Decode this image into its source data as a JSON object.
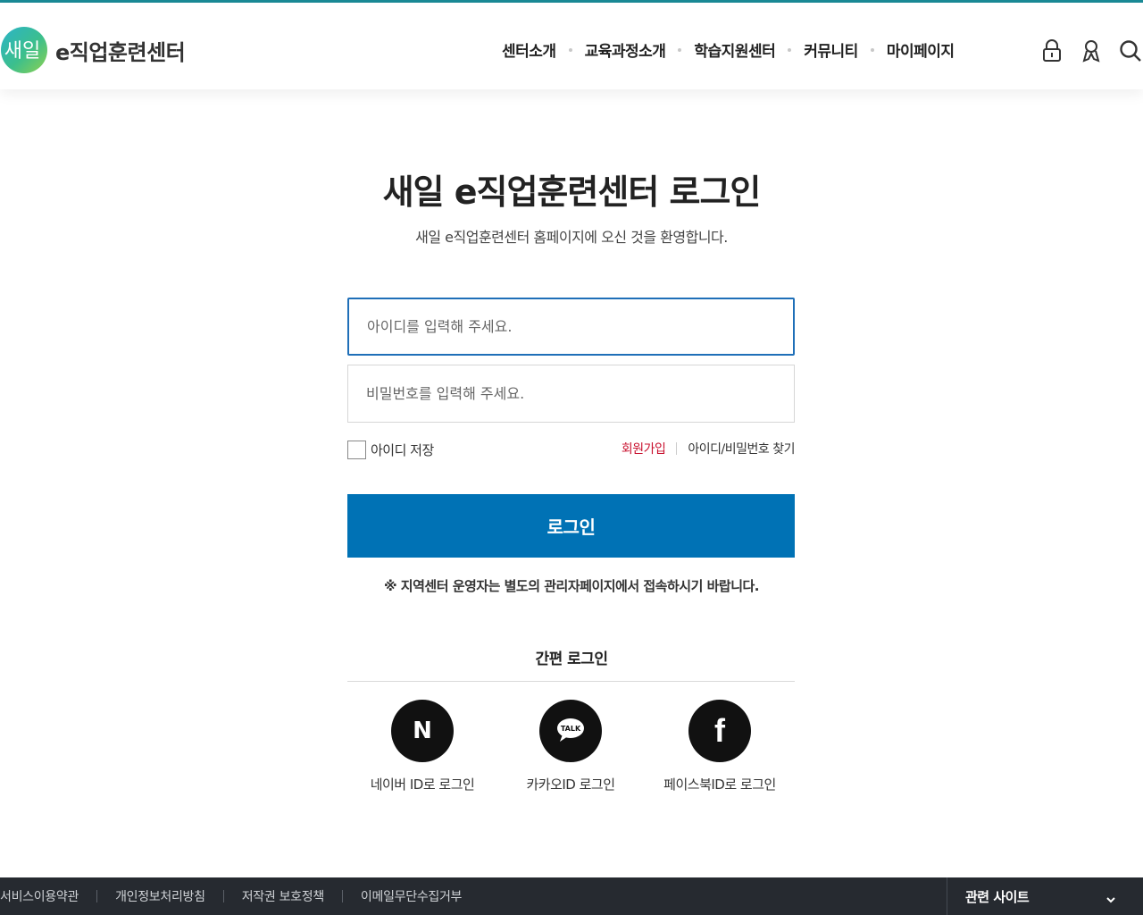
{
  "brand": {
    "mark_text": "새일",
    "name": "e직업훈련센터"
  },
  "nav": {
    "items": [
      {
        "id": "center",
        "label": "센터소개"
      },
      {
        "id": "course",
        "label": "교육과정소개"
      },
      {
        "id": "support",
        "label": "학습지원센터"
      },
      {
        "id": "community",
        "label": "커뮤니티"
      },
      {
        "id": "mypage",
        "label": "마이페이지"
      }
    ]
  },
  "utility": {
    "icons": [
      "lock-icon",
      "user-icon",
      "search-icon"
    ]
  },
  "login": {
    "title": "새일 e직업훈련센터 로그인",
    "subtitle": "새일 e직업훈련센터 홈페이지에 오신 것을 환영합니다.",
    "id_placeholder": "아이디를 입력해 주세요.",
    "pw_placeholder": "비밀번호를 입력해 주세요.",
    "save_id_label": "아이디 저장",
    "join_label": "회원가입",
    "find_label": "아이디/비밀번호 찾기",
    "button_label": "로그인",
    "notice": "※ 지역센터 운영자는 별도의 관리자페이지에서 접속하시기 바랍니다."
  },
  "easy_login": {
    "title": "간편 로그인",
    "providers": [
      {
        "id": "naver",
        "label": "네이버 ID로 로그인",
        "icon": "naver-icon",
        "glyph": "N"
      },
      {
        "id": "kakao",
        "label": "카카오ID 로그인",
        "icon": "kakao-talk-icon",
        "glyph": "TALK"
      },
      {
        "id": "facebook",
        "label": "페이스북ID로 로그인",
        "icon": "facebook-icon",
        "glyph": "f"
      }
    ]
  },
  "footer": {
    "links": [
      "서비스이용약관",
      "개인정보처리방침",
      "저작권 보호정책",
      "이메일무단수집거부"
    ],
    "family_site": "관련 사이트"
  },
  "colors": {
    "accent": "#0072b5",
    "focus_border": "#1f6fb8",
    "join_link": "#c8102e",
    "footer_bg": "#262a30",
    "top_strip": "#1a8a96"
  }
}
